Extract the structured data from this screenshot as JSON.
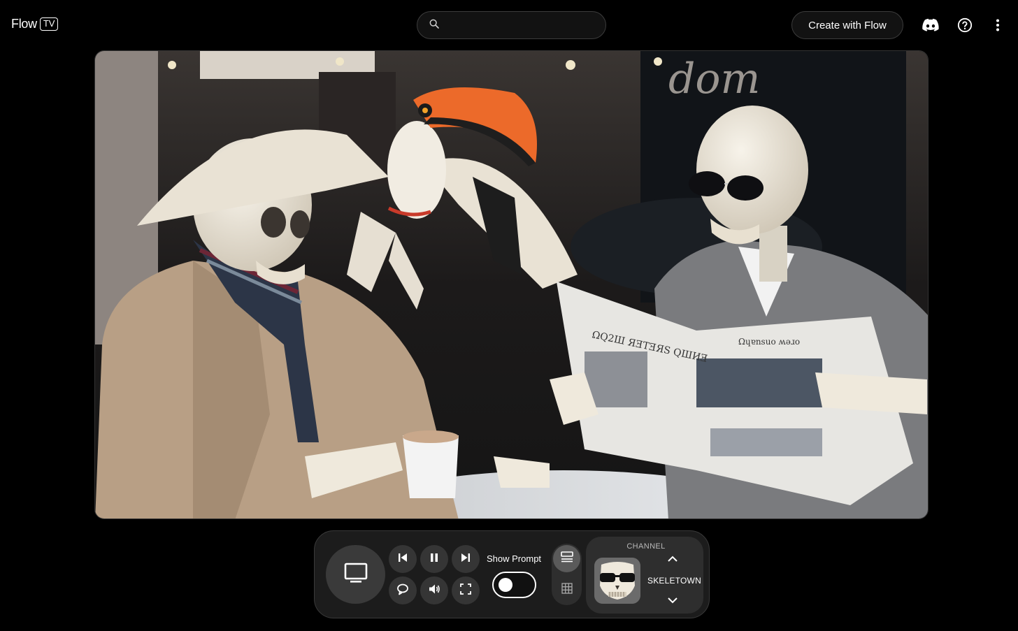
{
  "header": {
    "logo_text": "Flow",
    "logo_badge": "TV",
    "search_placeholder": "",
    "create_button": "Create with Flow",
    "icons": [
      "discord-icon",
      "help-icon",
      "more-vert-icon"
    ]
  },
  "player": {
    "video_description_icon": "video-frame"
  },
  "controls": {
    "show_prompt_label": "Show Prompt",
    "show_prompt_enabled": false,
    "playback_state": "playing",
    "channel": {
      "label": "CHANNEL",
      "name": "SKELETOWN"
    }
  },
  "colors": {
    "background": "#000000",
    "panel": "#1c1c1c",
    "button": "#353535"
  }
}
